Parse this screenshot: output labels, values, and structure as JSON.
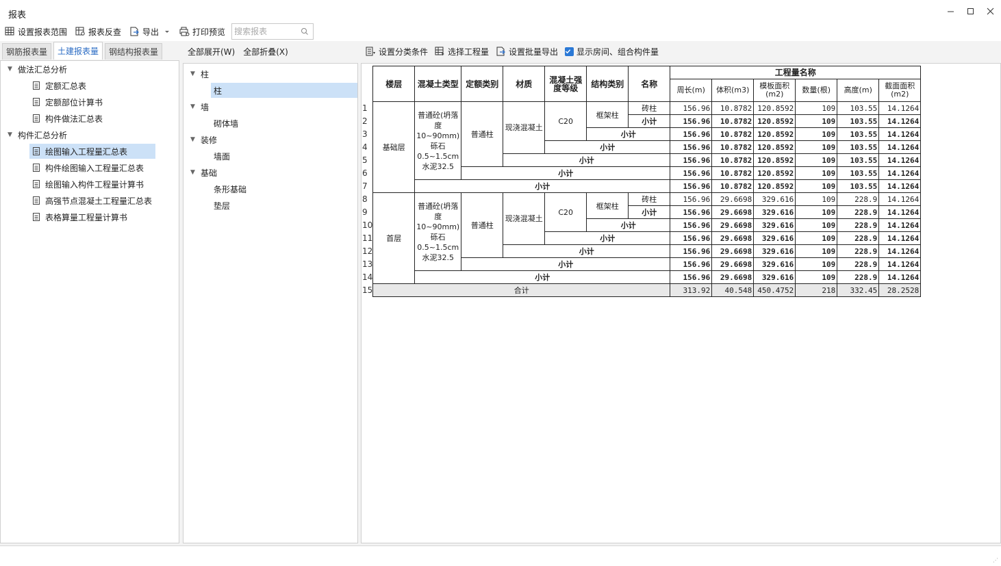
{
  "window": {
    "title": "报表",
    "controls": {
      "minimize": "—",
      "maximize": "☐",
      "close": "✕"
    }
  },
  "toolbar": {
    "buttons": [
      "设置报表范围",
      "报表反查",
      "导出",
      "打印预览"
    ],
    "search_placeholder": "搜索报表"
  },
  "left": {
    "tabs": [
      "钢筋报表量",
      "土建报表量",
      "钢结构报表量"
    ],
    "active_tab": 1,
    "groups": [
      {
        "label": "做法汇总分析",
        "items": [
          "定额汇总表",
          "定额部位计算书",
          "构件做法汇总表"
        ]
      },
      {
        "label": "构件汇总分析",
        "items": [
          "绘图输入工程量汇总表",
          "构件绘图输入工程量汇总表",
          "绘图输入构件工程量计算书",
          "高强节点混凝土工程量汇总表",
          "表格算量工程量计算书"
        ]
      }
    ],
    "selected_item": "绘图输入工程量汇总表"
  },
  "middle": {
    "actions": [
      "全部展开(W)",
      "全部折叠(X)"
    ],
    "groups": [
      {
        "label": "柱",
        "items": [
          "柱"
        ]
      },
      {
        "label": "墙",
        "items": [
          "砌体墙"
        ]
      },
      {
        "label": "装修",
        "items": [
          "墙面"
        ]
      },
      {
        "label": "基础",
        "items": [
          "条形基础",
          "垫层"
        ]
      }
    ],
    "selected_item": "柱"
  },
  "right": {
    "actions": [
      "设置分类条件",
      "选择工程量",
      "设置批量导出"
    ],
    "checkbox_label": "显示房间、组合构件量",
    "checkbox_checked": true
  },
  "report": {
    "headers": {
      "floor": "楼层",
      "concrete_type": "混凝土类型",
      "quota": "定额类别",
      "material": "材质",
      "grade": "混凝土强度等级",
      "struct": "结构类别",
      "name": "名称",
      "qty_group": "工程量名称",
      "qty": [
        "周长(m)",
        "体积(m3)",
        "模板面积(m2)",
        "数量(根)",
        "高度(m)",
        "截面面积(m2)"
      ]
    },
    "row_numbers": [
      "1",
      "2",
      "3",
      "4",
      "5",
      "6",
      "7",
      "8",
      "9",
      "10",
      "11",
      "12",
      "13",
      "14",
      "15"
    ],
    "subtotal_label": "小计",
    "total_label": "合计",
    "floors": [
      {
        "floor": "基础层",
        "concrete_type": "普通砼(坍落度10~90mm) 砾石0.5~1.5cm 水泥32.5",
        "quota": "普通柱",
        "material": "现浇混凝土",
        "grade": "C20",
        "struct": "框架柱",
        "name": "砖柱",
        "rows": [
          [
            "156.96",
            "10.8782",
            "120.8592",
            "109",
            "103.55",
            "14.1264"
          ],
          [
            "156.96",
            "10.8782",
            "120.8592",
            "109",
            "103.55",
            "14.1264"
          ],
          [
            "156.96",
            "10.8782",
            "120.8592",
            "109",
            "103.55",
            "14.1264"
          ],
          [
            "156.96",
            "10.8782",
            "120.8592",
            "109",
            "103.55",
            "14.1264"
          ],
          [
            "156.96",
            "10.8782",
            "120.8592",
            "109",
            "103.55",
            "14.1264"
          ],
          [
            "156.96",
            "10.8782",
            "120.8592",
            "109",
            "103.55",
            "14.1264"
          ],
          [
            "156.96",
            "10.8782",
            "120.8592",
            "109",
            "103.55",
            "14.1264"
          ]
        ]
      },
      {
        "floor": "首层",
        "concrete_type": "普通砼(坍落度10~90mm) 砾石0.5~1.5cm 水泥32.5",
        "quota": "普通柱",
        "material": "现浇混凝土",
        "grade": "C20",
        "struct": "框架柱",
        "name": "砖柱",
        "rows": [
          [
            "156.96",
            "29.6698",
            "329.616",
            "109",
            "228.9",
            "14.1264"
          ],
          [
            "156.96",
            "29.6698",
            "329.616",
            "109",
            "228.9",
            "14.1264"
          ],
          [
            "156.96",
            "29.6698",
            "329.616",
            "109",
            "228.9",
            "14.1264"
          ],
          [
            "156.96",
            "29.6698",
            "329.616",
            "109",
            "228.9",
            "14.1264"
          ],
          [
            "156.96",
            "29.6698",
            "329.616",
            "109",
            "228.9",
            "14.1264"
          ],
          [
            "156.96",
            "29.6698",
            "329.616",
            "109",
            "228.9",
            "14.1264"
          ],
          [
            "156.96",
            "29.6698",
            "329.616",
            "109",
            "228.9",
            "14.1264"
          ]
        ]
      }
    ],
    "total": [
      "313.92",
      "40.548",
      "450.4752",
      "218",
      "332.45",
      "28.2528"
    ]
  }
}
